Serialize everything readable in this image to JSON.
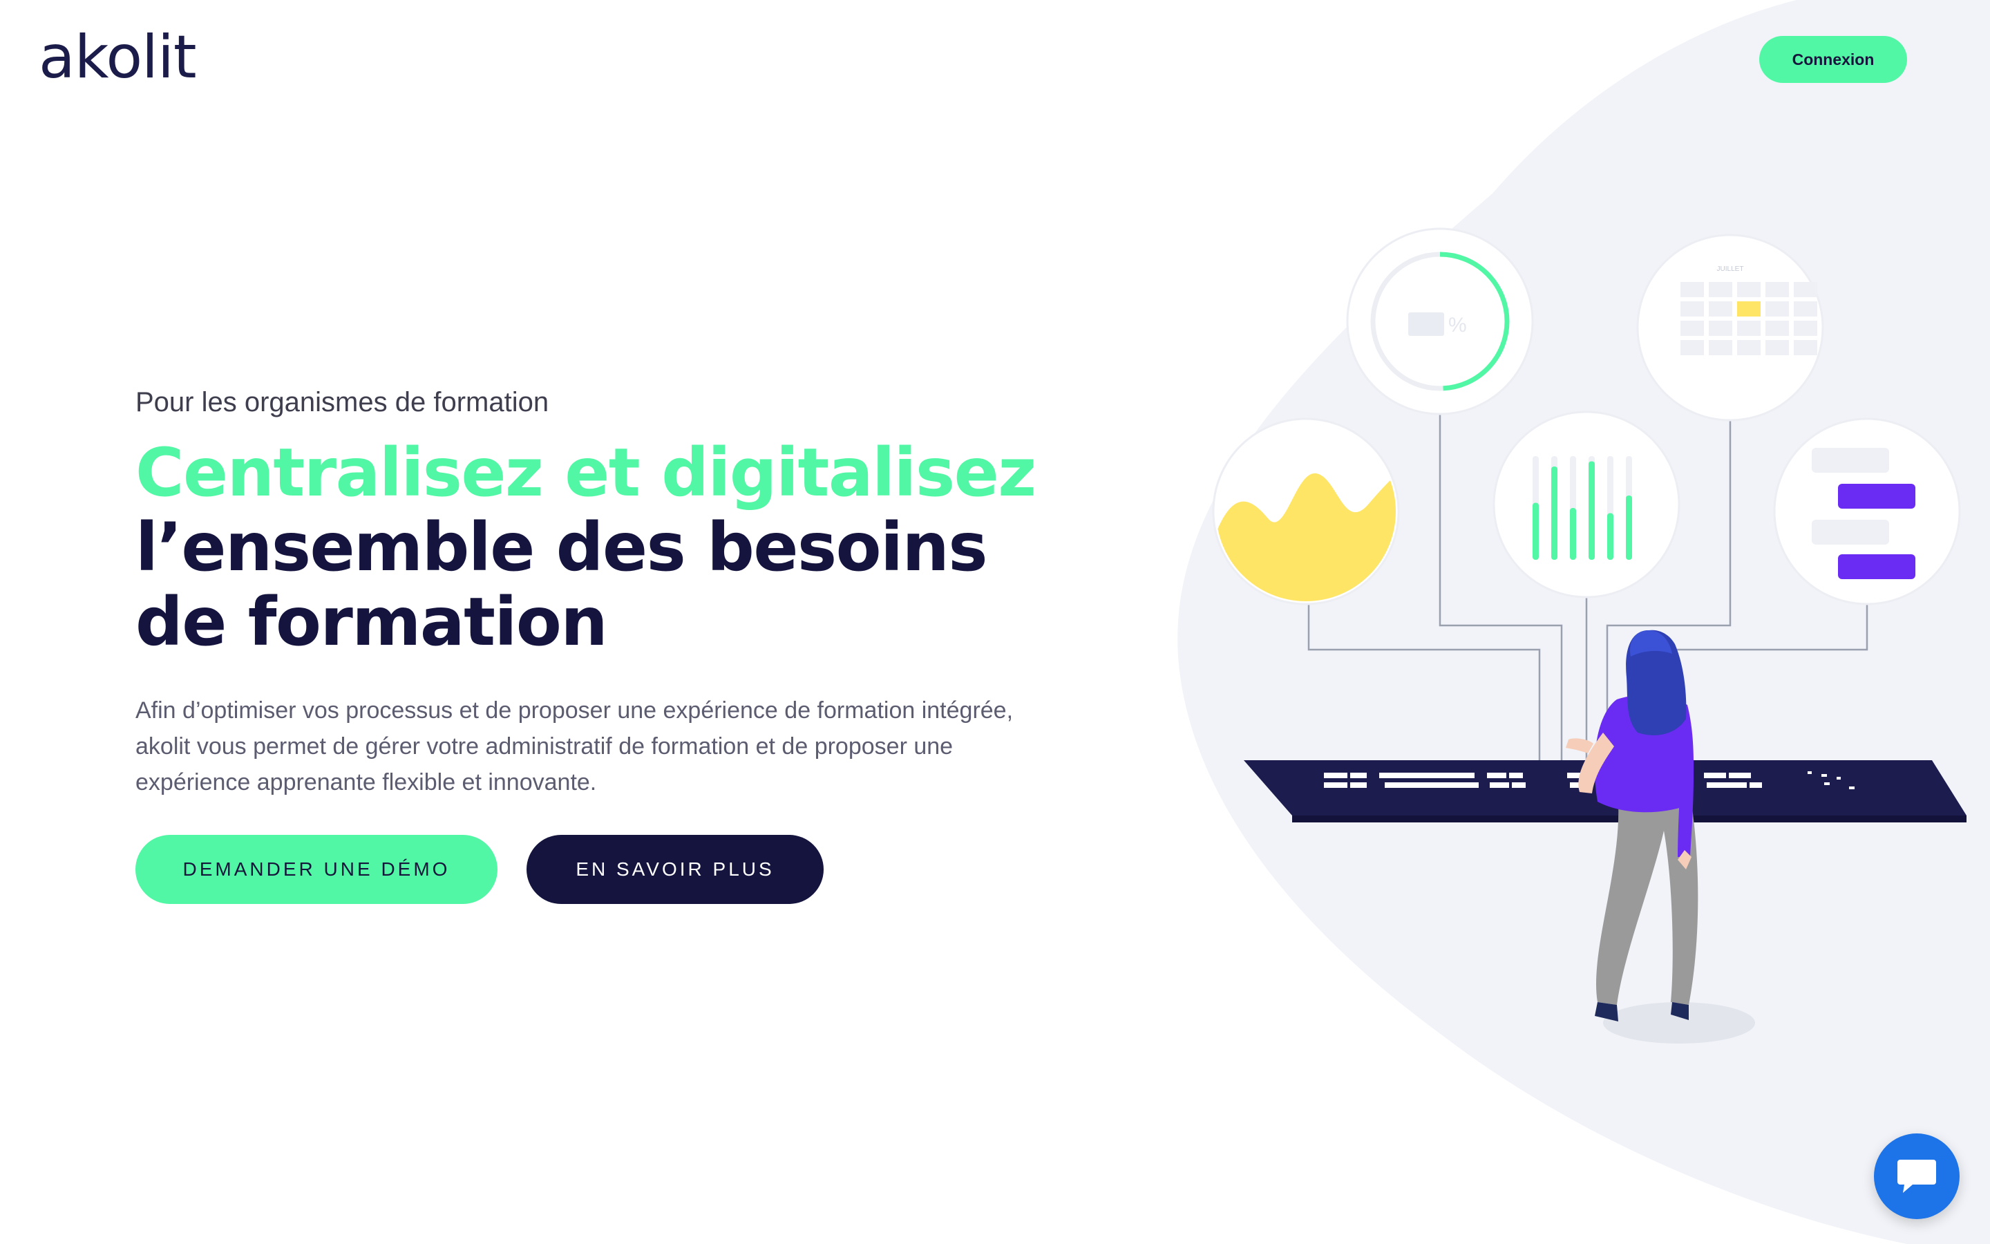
{
  "header": {
    "logo_text": "akolit",
    "login_label": "Connexion"
  },
  "hero": {
    "eyebrow": "Pour les organismes de formation",
    "headline_accent": "Centralisez et digitalisez",
    "headline_line2": "l’ensemble des besoins",
    "headline_line3": "de formation",
    "description": "Afin d’optimiser vos processus et de proposer une expérience de formation intégrée, akolit vous permet de gérer votre administratif de formation et de proposer une expérience apprenante flexible et innovante.",
    "cta_primary": "DEMANDER UNE DÉMO",
    "cta_secondary": "EN SAVOIR PLUS"
  },
  "illustration": {
    "percent_symbol": "%",
    "calendar_month": "JUILLET",
    "bar_levels": [
      0.55,
      0.9,
      0.5,
      0.95,
      0.45,
      0.62
    ]
  },
  "chat_widget": {
    "icon": "chat-bubble-icon"
  },
  "colors": {
    "accent": "#52f7a5",
    "navy": "#14143e",
    "purple": "#6a2cf2",
    "yellow": "#ffe566",
    "chat_blue": "#1d73e8",
    "blob": "#f1f3f8"
  }
}
